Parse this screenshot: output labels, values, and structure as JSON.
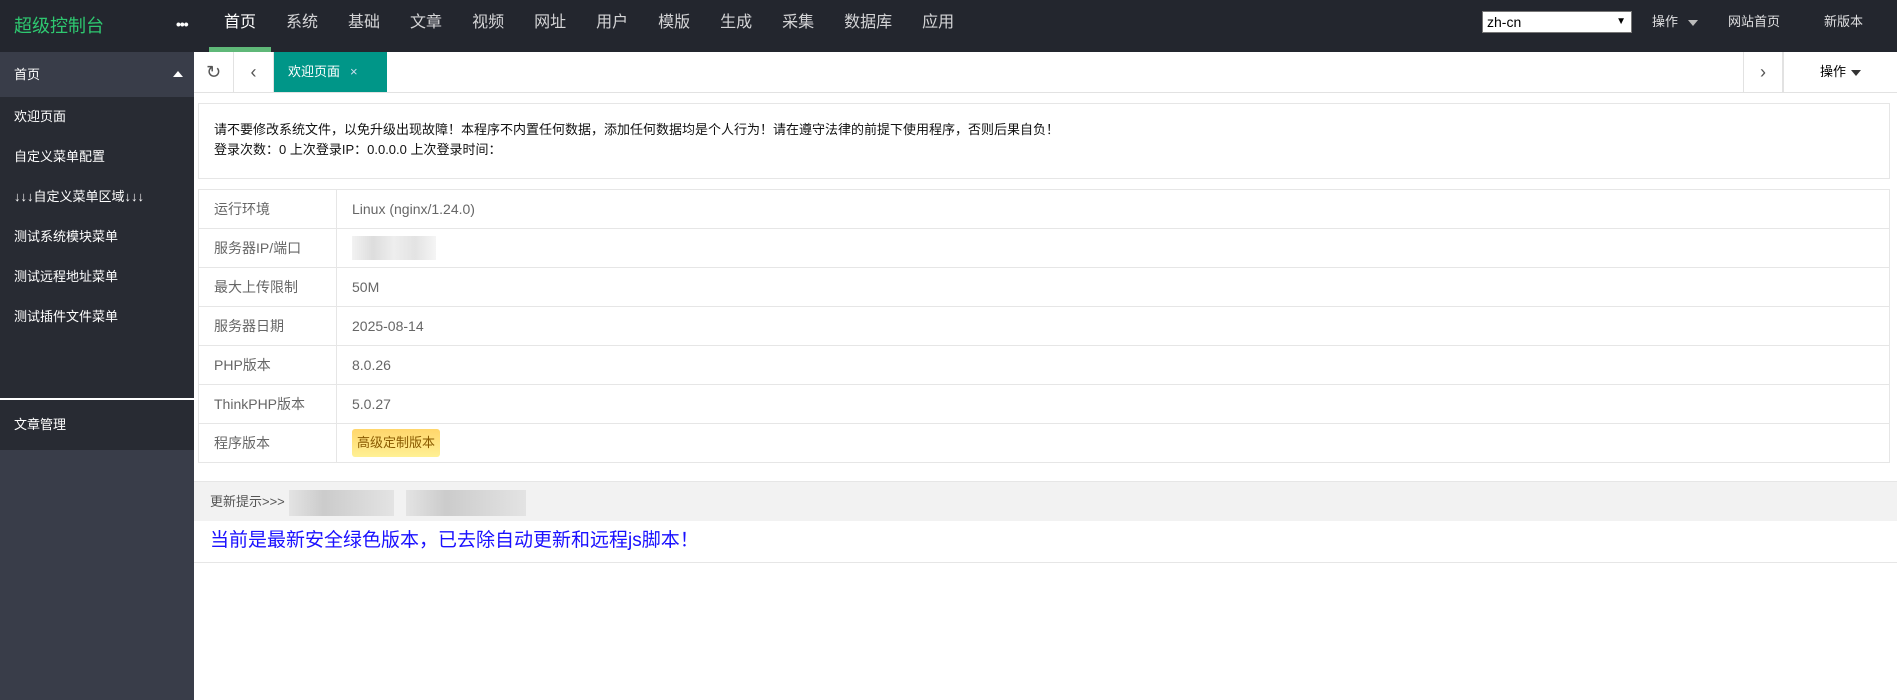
{
  "header": {
    "logo": "超级控制台",
    "more": "•••",
    "nav": [
      "首页",
      "系统",
      "基础",
      "文章",
      "视频",
      "网址",
      "用户",
      "模版",
      "生成",
      "采集",
      "数据库",
      "应用"
    ],
    "lang": "zh-cn",
    "ops": "操作",
    "site_home": "网站首页",
    "new_version": "新版本"
  },
  "sidebar": {
    "group": "首页",
    "items": [
      "欢迎页面",
      "自定义菜单配置",
      "↓↓↓自定义菜单区域↓↓↓",
      "测试系统模块菜单",
      "测试远程地址菜单",
      "测试插件文件菜单"
    ],
    "article": "文章管理"
  },
  "tabs": {
    "active": "欢迎页面",
    "close": "×",
    "ops": "操作"
  },
  "notice": {
    "line1": "请不要修改系统文件，以免升级出现故障！本程序不内置任何数据，添加任何数据均是个人行为！请在遵守法律的前提下使用程序，否则后果自负！",
    "line2": "登录次数：0 上次登录IP：0.0.0.0 上次登录时间："
  },
  "info": [
    {
      "label": "运行环境",
      "value": "Linux (nginx/1.24.0)"
    },
    {
      "label": "服务器IP/端口",
      "value": ""
    },
    {
      "label": "最大上传限制",
      "value": "50M"
    },
    {
      "label": "服务器日期",
      "value": "2025-08-14"
    },
    {
      "label": "PHP版本",
      "value": "8.0.26"
    },
    {
      "label": "ThinkPHP版本",
      "value": "5.0.27"
    },
    {
      "label": "程序版本",
      "value": "高级定制版本"
    }
  ],
  "update": {
    "label": "更新提示>>>"
  },
  "status": "当前是最新安全绿色版本，已去除自动更新和远程js脚本！"
}
